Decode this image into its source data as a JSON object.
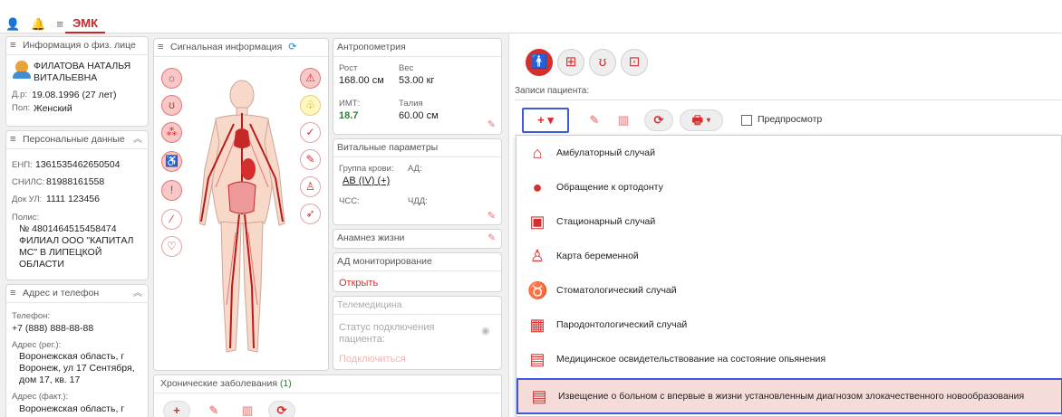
{
  "header": {
    "tab_emk": "ЭМК",
    "icons": [
      "user-icon",
      "bell-icon",
      "menu-icon"
    ]
  },
  "patient": {
    "section_title": "Информация о физ. лице",
    "name_line1": "ФИЛАТОВА НАТАЛЬЯ",
    "name_line2": "ВИТАЛЬЕВНА",
    "dob_label": "Д.р:",
    "dob_value": "19.08.1996 (27 лет)",
    "sex_label": "Пол:",
    "sex_value": "Женский"
  },
  "personal": {
    "section_title": "Персональные данные",
    "enp_label": "ЕНП:",
    "enp_value": "1361535462650504",
    "snils_label": "СНИЛС:",
    "snils_value": "81988161558",
    "doc_label": "Док УЛ:",
    "doc_value": "1111 123456",
    "polis_label": "Полис:",
    "polis_line1": "№ 4801464515458474",
    "polis_line2": "ФИЛИАЛ ООО \"КАПИТАЛ",
    "polis_line3": "МС\" В ЛИПЕЦКОЙ",
    "polis_line4": "ОБЛАСТИ"
  },
  "address": {
    "section_title": "Адрес и телефон",
    "phone_label": "Телефон:",
    "phone_value": "+7 (888) 888-88-88",
    "reg_label": "Адрес (рег.):",
    "reg_line1": "Воронежская область, г",
    "reg_line2": "Воронеж, ул 17 Сентября,",
    "reg_line3": "дом 17, кв. 17",
    "fact_label": "Адрес (факт.):",
    "fact_line1": "Воронежская область, г"
  },
  "signal": {
    "section_title": "Сигнальная информация"
  },
  "chronic": {
    "section_title": "Хронические заболевания",
    "count": "(1)"
  },
  "anthropometry": {
    "section_title": "Антропометрия",
    "height_label": "Рост",
    "height_value": "168.00 см",
    "weight_label": "Вес",
    "weight_value": "53.00 кг",
    "bmi_label": "ИМТ:",
    "bmi_value": "18.7",
    "waist_label": "Талия",
    "waist_value": "60.00 см"
  },
  "vitals": {
    "section_title": "Витальные параметры",
    "blood_label": "Группа крови:",
    "blood_value": "AB (IV) (+)",
    "bp_label": "АД:",
    "hr_label": "ЧСС:",
    "rr_label": "ЧДД:"
  },
  "anamnesis": {
    "section_title": "Анамнез жизни"
  },
  "bp_monitor": {
    "section_title": "АД мониторирование",
    "open_link": "Открыть"
  },
  "telemed": {
    "section_title": "Телемедицина",
    "status_line1": "Статус подключения",
    "status_line2": "пациента:",
    "connect_link": "Подключиться"
  },
  "records": {
    "title": "Записи пациента:",
    "preview_label": "Предпросмотр",
    "menu_items": [
      "Амбулаторный случай",
      "Обращение к ортодонту",
      "Стационарный случай",
      "Карта беременной",
      "Стоматологический случай",
      "Пародонтологический случай",
      "Медицинское освидетельствование на состояние опьянения",
      "Извещение о больном с впервые в жизни установленным диагнозом злокачественного новообразования"
    ]
  },
  "colors": {
    "accent": "#d32f2f",
    "highlight": "#f6dcd8",
    "focus_border": "#3b5bdb",
    "bmi_green": "#2e7d32"
  }
}
